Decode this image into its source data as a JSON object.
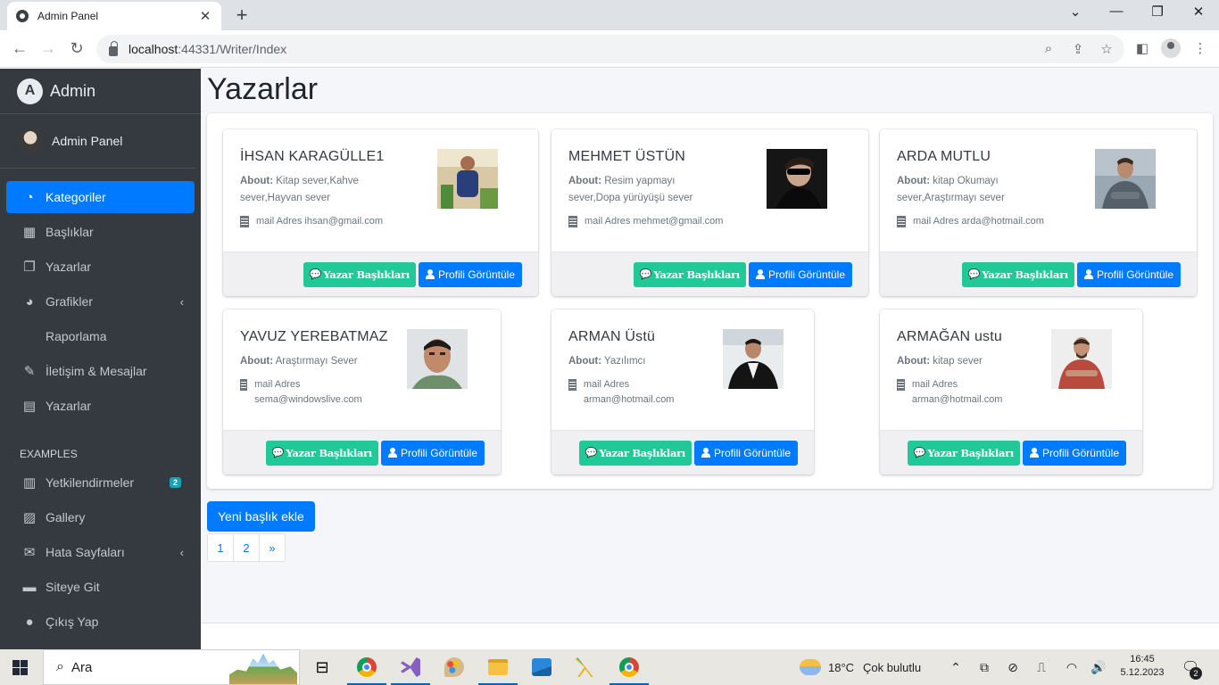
{
  "browser": {
    "tab_title": "Admin Panel",
    "tab_close": "✕",
    "new_tab": "+",
    "url_host": "localhost",
    "url_rest": ":44331/Writer/Index",
    "win_minimize": "—",
    "win_restore": "❐",
    "win_close": "✕",
    "tab_dropdown": "⌄"
  },
  "sidebar": {
    "brand": "Admin",
    "user_name": "Admin Panel",
    "items": [
      {
        "label": "Kategoriler",
        "icon": "tachometer-icon",
        "active": true
      },
      {
        "label": "Başlıklar",
        "icon": "grid-icon"
      },
      {
        "label": "Yazarlar",
        "icon": "copy-icon"
      },
      {
        "label": "Grafikler",
        "icon": "chart-pie-icon",
        "chevron": "‹"
      },
      {
        "label": "Raporlama"
      },
      {
        "label": "İletişim & Mesajlar",
        "icon": "edit-icon"
      },
      {
        "label": "Yazarlar",
        "icon": "table-icon"
      }
    ],
    "header": "EXAMPLES",
    "items2": [
      {
        "label": "Yetkilendirmeler",
        "icon": "calendar-icon",
        "badge": "2"
      },
      {
        "label": "Gallery",
        "icon": "image-icon"
      },
      {
        "label": "Hata Sayfaları",
        "icon": "envelope-icon",
        "chevron": "‹"
      },
      {
        "label": "Siteye Git",
        "icon": "book-icon"
      },
      {
        "label": "Çıkış Yap",
        "icon": "apple-icon"
      }
    ]
  },
  "main": {
    "title": "Yazarlar",
    "writers": [
      {
        "name": "İHSAN KARAGÜLLE1",
        "about_label": "About:",
        "about": "Kitap sever,Kahve sever,Hayvan sever",
        "mail_label": "mail Adres",
        "mail": "ihsan@gmail.com"
      },
      {
        "name": "MEHMET ÜSTÜN",
        "about_label": "About:",
        "about": "Resim yapmayı sever,Dopa yürüyüşü sever",
        "mail_label": "mail Adres",
        "mail": "mehmet@gmail.com"
      },
      {
        "name": "ARDA MUTLU",
        "about_label": "About:",
        "about": "kitap Okumayı sever,Araştırmayı sever",
        "mail_label": "mail Adres",
        "mail": "arda@hotmail.com"
      },
      {
        "name": "YAVUZ YEREBATMAZ",
        "about_label": "About:",
        "about": "Araştırmayı Sever",
        "mail_label": "mail Adres",
        "mail": "sema@windowslive.com"
      },
      {
        "name": "ARMAN Üstü",
        "about_label": "About:",
        "about": "Yazılımcı",
        "mail_label": "mail Adres",
        "mail": "arman@hotmail.com"
      },
      {
        "name": "ARMAĞAN ustu",
        "about_label": "About:",
        "about": "kitap sever",
        "mail_label": "mail Adres",
        "mail": "arman@hotmail.com"
      }
    ],
    "btn_titles": "Yazar Başlıkları",
    "btn_profile": "Profili Görüntüle",
    "btn_new": "Yeni başlık ekle",
    "pages": [
      "1",
      "2",
      "»"
    ]
  },
  "taskbar": {
    "search_placeholder": "Ara",
    "weather_temp": "18°C",
    "weather_text": "Çok bulutlu",
    "time": "16:45",
    "date": "5.12.2023",
    "notif_count": "2"
  }
}
